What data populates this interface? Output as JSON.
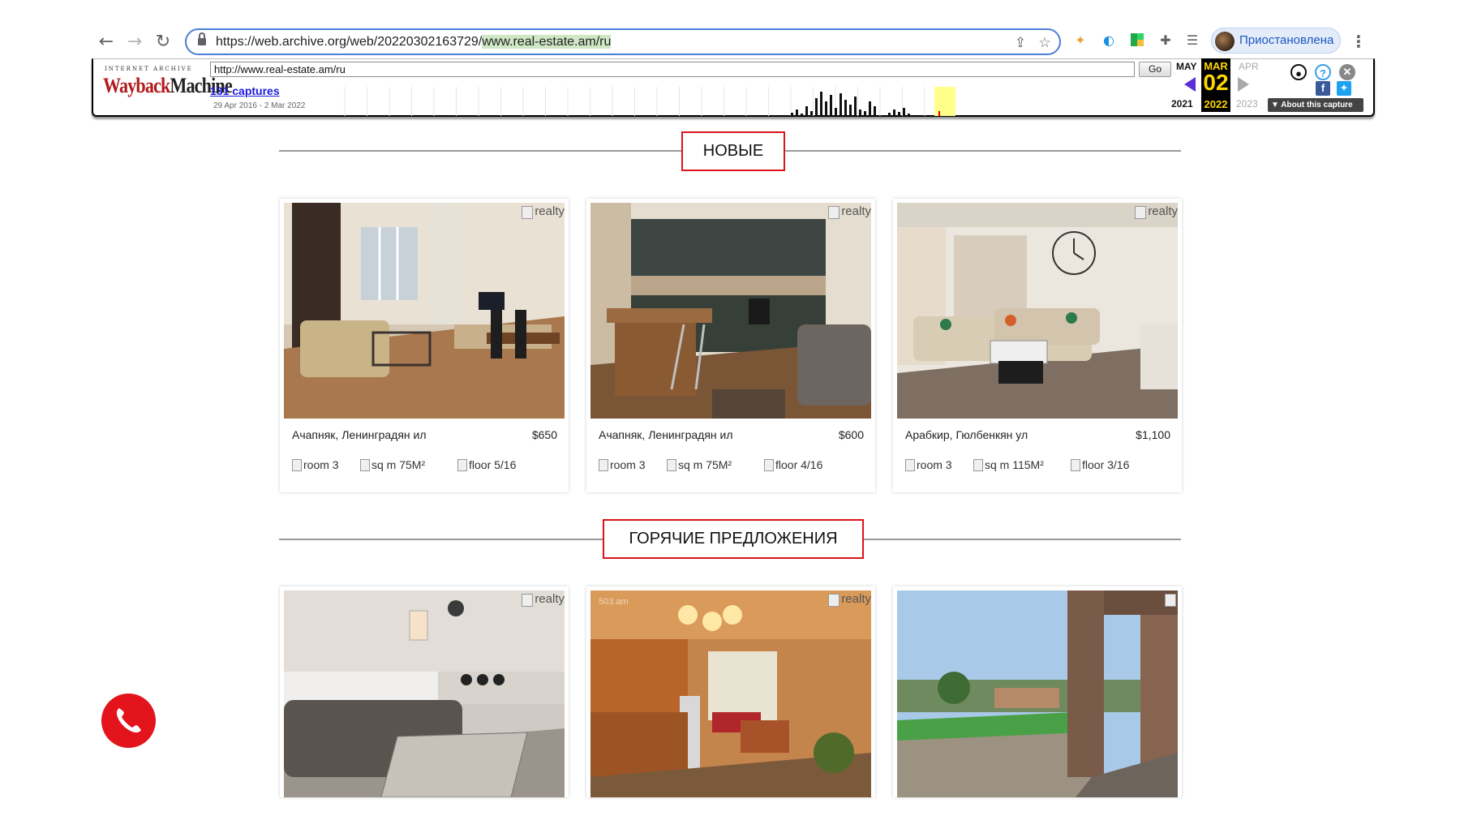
{
  "browser": {
    "url_prefix": "https://web.archive.org/web/20220302163729/",
    "url_highlight": "www.real-estate.am/ru",
    "profile_label": "Приостановлена"
  },
  "wayback": {
    "logo_top": "INTERNET ARCHIVE",
    "logo_way": "Wayback",
    "logo_machine": "Machine",
    "url_value": "http://www.real-estate.am/ru",
    "go_label": "Go",
    "captures_label": "131 captures",
    "range_label": "29 Apr 2016 - 2 Mar 2022",
    "prev_month": "MAY",
    "prev_year": "2021",
    "cur_month": "MAR",
    "cur_day": "02",
    "cur_year": "2022",
    "next_month": "APR",
    "next_year": "2023",
    "about_label": "▼ About this capture",
    "help_glyph": "?",
    "fb_glyph": "f"
  },
  "sections": [
    {
      "title": "НОВЫЕ"
    },
    {
      "title": "ГОРЯЧИЕ ПРЕДЛОЖЕНИЯ"
    }
  ],
  "new_listings": [
    {
      "badge": "realty",
      "address": "Ачапняк, Ленинградян ил",
      "price": "$650",
      "room": "room 3",
      "sqm": "sq m 75M²",
      "floor": "floor 5/16"
    },
    {
      "badge": "realty",
      "address": "Ачапняк, Ленинградян ил",
      "price": "$600",
      "room": "room 3",
      "sqm": "sq m 75M²",
      "floor": "floor 4/16"
    },
    {
      "badge": "realty",
      "address": "Арабкир, Гюлбенкян ул",
      "price": "$1,100",
      "room": "room 3",
      "sqm": "sq m 115M²",
      "floor": "floor 3/16"
    }
  ],
  "hot_listings": [
    {
      "badge": "realty"
    },
    {
      "badge": "realty",
      "watermark": "503.am"
    },
    {
      "badge": ""
    }
  ]
}
